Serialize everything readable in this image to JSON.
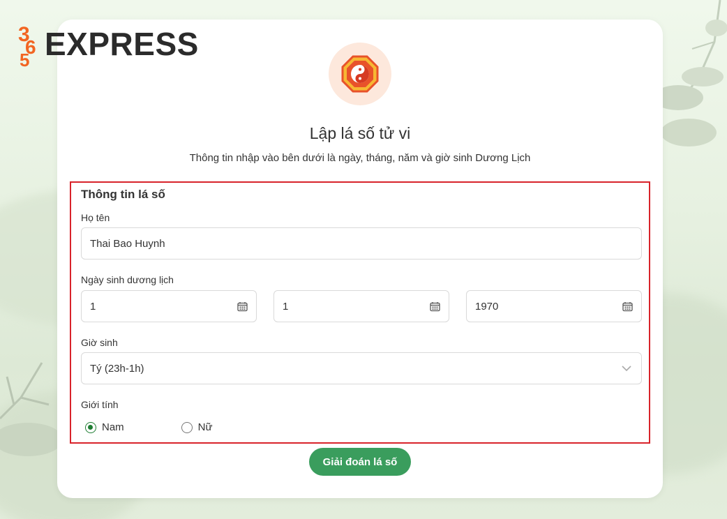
{
  "brand": {
    "logo_text": "EXPRESS",
    "logo_mark": "365"
  },
  "header": {
    "emblem_icon": "yin-yang-bagua-icon",
    "title": "Lập lá số tử vi",
    "subtitle": "Thông tin nhập vào bên dưới là ngày, tháng, năm và giờ sinh Dương Lịch"
  },
  "form": {
    "section_title": "Thông tin lá số",
    "name": {
      "label": "Họ tên",
      "value": "Thai Bao Huynh"
    },
    "birth_date": {
      "label": "Ngày sinh dương lịch",
      "day": "1",
      "month": "1",
      "year": "1970",
      "icon": "calendar-icon"
    },
    "birth_hour": {
      "label": "Giờ sinh",
      "value": "Tý (23h-1h)",
      "icon": "chevron-down-icon"
    },
    "gender": {
      "label": "Giới tính",
      "options": [
        {
          "label": "Nam",
          "checked": true
        },
        {
          "label": "Nữ",
          "checked": false
        }
      ]
    },
    "submit_label": "Giải đoán lá số"
  },
  "colors": {
    "accent_green": "#3a9d5d",
    "radio_green": "#1e7d32",
    "highlight_red": "#d8232a",
    "emblem_bg": "#fde8dc",
    "logo_orange": "#f26522"
  }
}
